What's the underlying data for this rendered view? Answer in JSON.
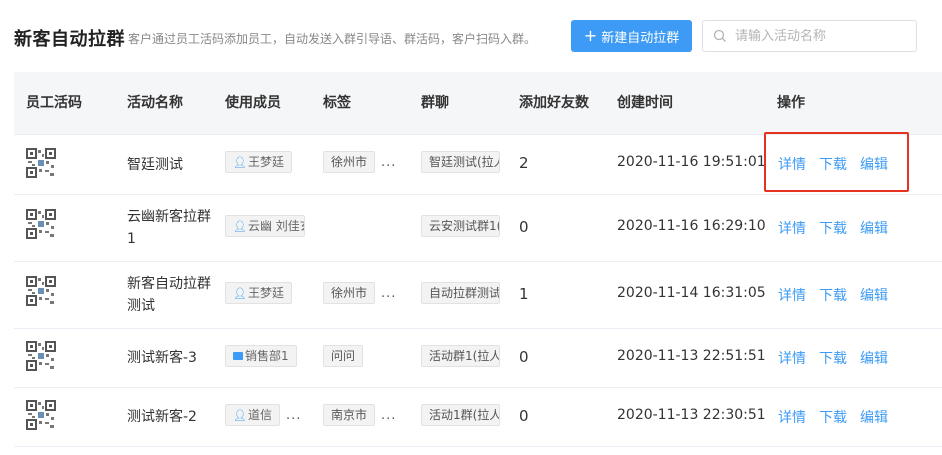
{
  "header": {
    "title": "新客自动拉群",
    "description": "客户通过员工活码添加员工，自动发送入群引导语、群活码，客户扫码入群。",
    "new_button_label": "新建自动拉群",
    "search_placeholder": "请输入活动名称"
  },
  "table": {
    "columns": [
      "员工活码",
      "活动名称",
      "使用成员",
      "标签",
      "群聊",
      "添加好友数",
      "创建时间",
      "操作"
    ],
    "actions": {
      "detail": "详情",
      "download": "下载",
      "edit": "编辑"
    },
    "rows": [
      {
        "name": "智廷测试",
        "member": "王梦廷",
        "member_type": "person",
        "tag": "徐州市",
        "tag_more": "...",
        "group": "智廷测试(拉人",
        "friends": "2",
        "created": "2020-11-16 19:51:01"
      },
      {
        "name": "云幽新客拉群1",
        "member": "云幽 刘佳玄",
        "member_type": "person",
        "tag": "",
        "tag_more": "",
        "group": "云安测试群1(",
        "friends": "0",
        "created": "2020-11-16 16:29:10"
      },
      {
        "name": "新客自动拉群测试",
        "member": "王梦廷",
        "member_type": "person",
        "tag": "徐州市",
        "tag_more": "...",
        "group": "自动拉群测试",
        "friends": "1",
        "created": "2020-11-14 16:31:05"
      },
      {
        "name": "测试新客-3",
        "member": "销售部1",
        "member_type": "department",
        "tag": "问问",
        "tag_more": "",
        "group": "活动群1(拉人",
        "friends": "0",
        "created": "2020-11-13 22:51:51"
      },
      {
        "name": "测试新客-2",
        "member": "道信",
        "member_type": "person",
        "tag": "南京市",
        "tag_more": "...",
        "group": "活动1群(拉人",
        "friends": "0",
        "created": "2020-11-13 22:30:51",
        "member_more": "..."
      }
    ]
  },
  "colors": {
    "accent": "#3d9bf5",
    "highlight": "#e8321f"
  }
}
